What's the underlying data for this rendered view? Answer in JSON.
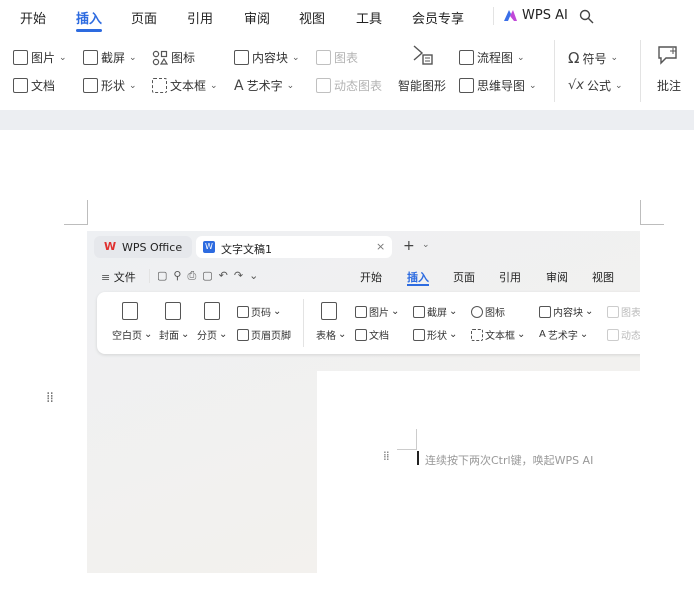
{
  "menu_tabs": [
    "开始",
    "插入",
    "页面",
    "引用",
    "审阅",
    "视图",
    "工具",
    "会员专享"
  ],
  "wps_ai_label": "WPS AI",
  "ribbon": {
    "picture": "图片",
    "screenshot": "截屏",
    "icons": "图标",
    "content_block": "内容块",
    "chart": "图表",
    "flowchart": "流程图",
    "symbol": "符号",
    "document": "文档",
    "shape": "形状",
    "textbox": "文本框",
    "wordart": "艺术字",
    "dynamic_chart": "动态图表",
    "smart_graphic": "智能图形",
    "mindmap": "思维导图",
    "formula": "公式",
    "comment": "批注"
  },
  "inner": {
    "wps_office_tab": "WPS Office",
    "doc_tab": "文字文稿1",
    "file_menu": "文件",
    "menu_tabs": [
      "开始",
      "插入",
      "页面",
      "引用",
      "审阅",
      "视图"
    ],
    "ribbon": {
      "blank_page": "空白页",
      "cover": "封面",
      "section": "分页",
      "page_number": "页码",
      "header_footer": "页眉页脚",
      "table": "表格",
      "picture": "图片",
      "document": "文档",
      "screenshot": "截屏",
      "icons": "图标",
      "shape": "形状",
      "textbox": "文本框",
      "content_block": "内容块",
      "wordart": "艺术字",
      "chart_partial": "图表",
      "dynamic_partial": "动态"
    },
    "placeholder_hint": "连续按下两次Ctrl键，唤起WPS AI"
  }
}
